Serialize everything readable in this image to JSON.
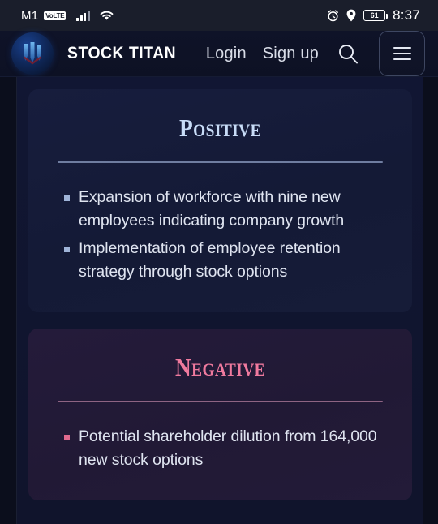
{
  "statusbar": {
    "carrier": "M1",
    "volte_badge": "VoLTE",
    "signal_icon": "signal-bars-icon",
    "wifi_icon": "wifi-icon",
    "alarm_icon": "alarm-clock-icon",
    "location_icon": "location-pin-icon",
    "battery_level": "61",
    "time": "8:37"
  },
  "header": {
    "logo_icon": "stock-titan-logo-icon",
    "brand": "STOCK TITAN",
    "login_label": "Login",
    "signup_label": "Sign up",
    "search_icon": "search-icon",
    "menu_icon": "hamburger-menu-icon"
  },
  "cards": [
    {
      "title": "Positive",
      "accent": "#c8dcf7",
      "bullets": [
        "Expansion of workforce with nine new employees indicating company growth",
        "Implementation of employee retention strategy through stock options"
      ]
    },
    {
      "title": "Negative",
      "accent": "#f07a9e",
      "bullets": [
        "Potential shareholder dilution from 164,000 new stock options"
      ]
    }
  ]
}
